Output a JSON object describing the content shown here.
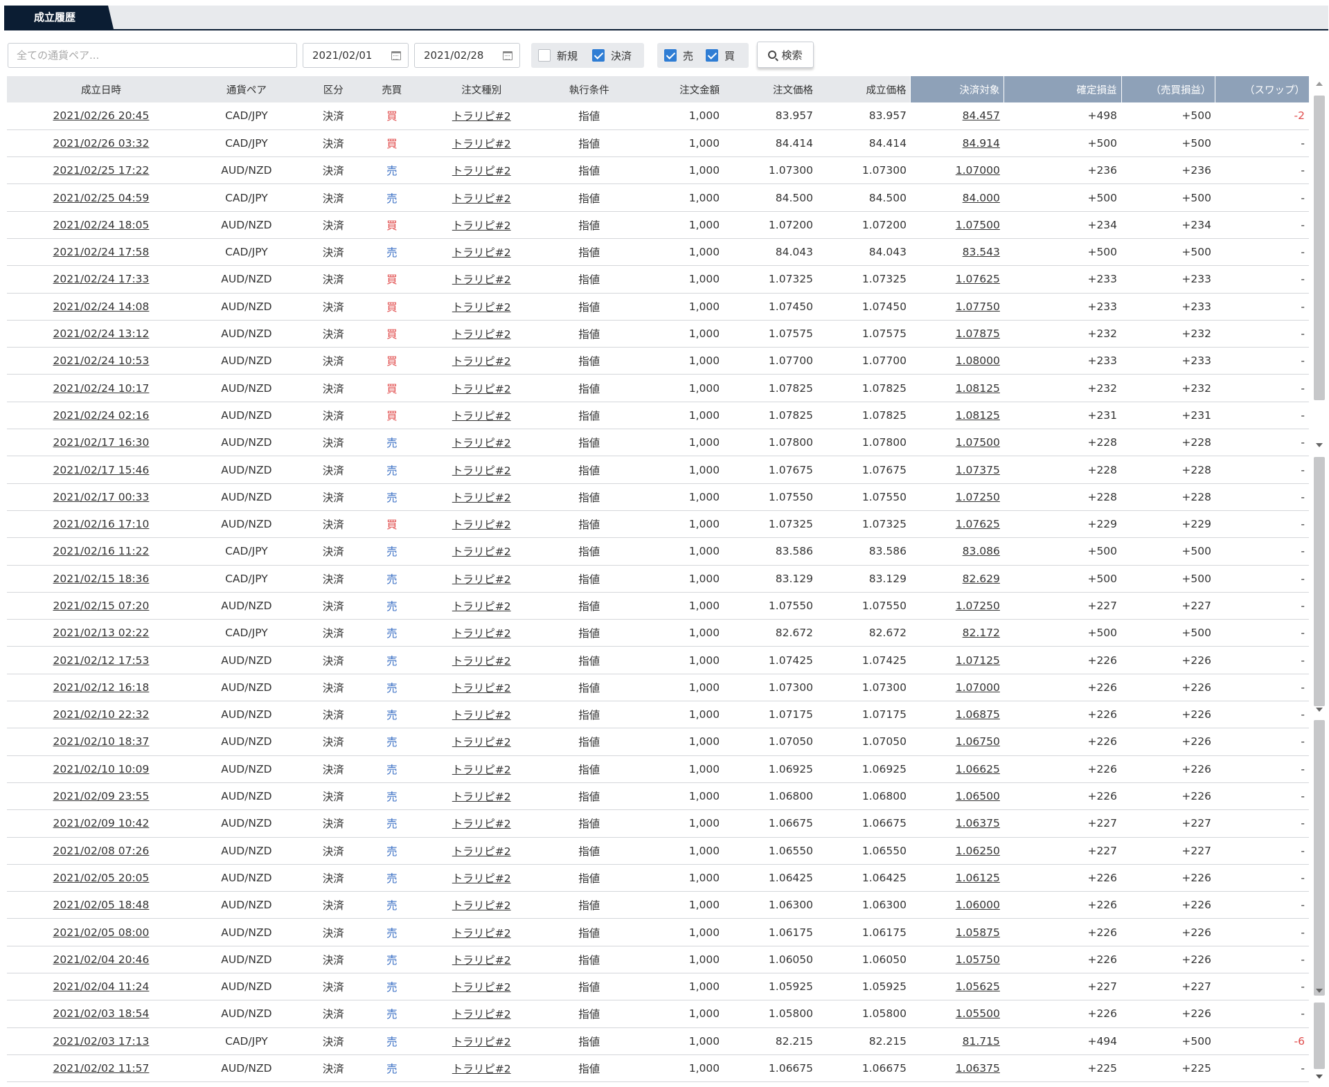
{
  "tabs": [
    {
      "label": "成立履歴"
    }
  ],
  "filters": {
    "pair_placeholder": "全ての通貨ペア...",
    "date_from": "2021/02/01",
    "date_to": "2021/02/28",
    "type_group": [
      {
        "label": "新規",
        "checked": false
      },
      {
        "label": "決済",
        "checked": true
      }
    ],
    "side_group": [
      {
        "label": "売",
        "checked": true
      },
      {
        "label": "買",
        "checked": true
      }
    ],
    "search_label": "検索"
  },
  "table": {
    "headers": [
      "成立日時",
      "通貨ペア",
      "区分",
      "売買",
      "注文種別",
      "執行条件",
      "注文金額",
      "注文価格",
      "成立価格",
      "決済対象",
      "確定損益",
      "（売買損益）",
      "（スワップ）"
    ],
    "colors": {
      "buy": "#e04a4a",
      "sell": "#3a6fc4",
      "highlight_header": "#8ea1b8",
      "negative": "#e04a4a"
    },
    "rows": [
      [
        "2021/02/26 20:45",
        "CAD/JPY",
        "決済",
        "買",
        "トラリピ#2",
        "指値",
        "1,000",
        "83.957",
        "83.957",
        "84.457",
        "+498",
        "+500",
        "-2"
      ],
      [
        "2021/02/26 03:32",
        "CAD/JPY",
        "決済",
        "買",
        "トラリピ#2",
        "指値",
        "1,000",
        "84.414",
        "84.414",
        "84.914",
        "+500",
        "+500",
        "-"
      ],
      [
        "2021/02/25 17:22",
        "AUD/NZD",
        "決済",
        "売",
        "トラリピ#2",
        "指値",
        "1,000",
        "1.07300",
        "1.07300",
        "1.07000",
        "+236",
        "+236",
        "-"
      ],
      [
        "2021/02/25 04:59",
        "CAD/JPY",
        "決済",
        "売",
        "トラリピ#2",
        "指値",
        "1,000",
        "84.500",
        "84.500",
        "84.000",
        "+500",
        "+500",
        "-"
      ],
      [
        "2021/02/24 18:05",
        "AUD/NZD",
        "決済",
        "買",
        "トラリピ#2",
        "指値",
        "1,000",
        "1.07200",
        "1.07200",
        "1.07500",
        "+234",
        "+234",
        "-"
      ],
      [
        "2021/02/24 17:58",
        "CAD/JPY",
        "決済",
        "売",
        "トラリピ#2",
        "指値",
        "1,000",
        "84.043",
        "84.043",
        "83.543",
        "+500",
        "+500",
        "-"
      ],
      [
        "2021/02/24 17:33",
        "AUD/NZD",
        "決済",
        "買",
        "トラリピ#2",
        "指値",
        "1,000",
        "1.07325",
        "1.07325",
        "1.07625",
        "+233",
        "+233",
        "-"
      ],
      [
        "2021/02/24 14:08",
        "AUD/NZD",
        "決済",
        "買",
        "トラリピ#2",
        "指値",
        "1,000",
        "1.07450",
        "1.07450",
        "1.07750",
        "+233",
        "+233",
        "-"
      ],
      [
        "2021/02/24 13:12",
        "AUD/NZD",
        "決済",
        "買",
        "トラリピ#2",
        "指値",
        "1,000",
        "1.07575",
        "1.07575",
        "1.07875",
        "+232",
        "+232",
        "-"
      ],
      [
        "2021/02/24 10:53",
        "AUD/NZD",
        "決済",
        "買",
        "トラリピ#2",
        "指値",
        "1,000",
        "1.07700",
        "1.07700",
        "1.08000",
        "+233",
        "+233",
        "-"
      ],
      [
        "2021/02/24 10:17",
        "AUD/NZD",
        "決済",
        "買",
        "トラリピ#2",
        "指値",
        "1,000",
        "1.07825",
        "1.07825",
        "1.08125",
        "+232",
        "+232",
        "-"
      ],
      [
        "2021/02/24 02:16",
        "AUD/NZD",
        "決済",
        "買",
        "トラリピ#2",
        "指値",
        "1,000",
        "1.07825",
        "1.07825",
        "1.08125",
        "+231",
        "+231",
        "-"
      ],
      [
        "2021/02/17 16:30",
        "AUD/NZD",
        "決済",
        "売",
        "トラリピ#2",
        "指値",
        "1,000",
        "1.07800",
        "1.07800",
        "1.07500",
        "+228",
        "+228",
        "-"
      ],
      [
        "2021/02/17 15:46",
        "AUD/NZD",
        "決済",
        "売",
        "トラリピ#2",
        "指値",
        "1,000",
        "1.07675",
        "1.07675",
        "1.07375",
        "+228",
        "+228",
        "-"
      ],
      [
        "2021/02/17 00:33",
        "AUD/NZD",
        "決済",
        "売",
        "トラリピ#2",
        "指値",
        "1,000",
        "1.07550",
        "1.07550",
        "1.07250",
        "+228",
        "+228",
        "-"
      ],
      [
        "2021/02/16 17:10",
        "AUD/NZD",
        "決済",
        "買",
        "トラリピ#2",
        "指値",
        "1,000",
        "1.07325",
        "1.07325",
        "1.07625",
        "+229",
        "+229",
        "-"
      ],
      [
        "2021/02/16 11:22",
        "CAD/JPY",
        "決済",
        "売",
        "トラリピ#2",
        "指値",
        "1,000",
        "83.586",
        "83.586",
        "83.086",
        "+500",
        "+500",
        "-"
      ],
      [
        "2021/02/15 18:36",
        "CAD/JPY",
        "決済",
        "売",
        "トラリピ#2",
        "指値",
        "1,000",
        "83.129",
        "83.129",
        "82.629",
        "+500",
        "+500",
        "-"
      ],
      [
        "2021/02/15 07:20",
        "AUD/NZD",
        "決済",
        "売",
        "トラリピ#2",
        "指値",
        "1,000",
        "1.07550",
        "1.07550",
        "1.07250",
        "+227",
        "+227",
        "-"
      ],
      [
        "2021/02/13 02:22",
        "CAD/JPY",
        "決済",
        "売",
        "トラリピ#2",
        "指値",
        "1,000",
        "82.672",
        "82.672",
        "82.172",
        "+500",
        "+500",
        "-"
      ],
      [
        "2021/02/12 17:53",
        "AUD/NZD",
        "決済",
        "売",
        "トラリピ#2",
        "指値",
        "1,000",
        "1.07425",
        "1.07425",
        "1.07125",
        "+226",
        "+226",
        "-"
      ],
      [
        "2021/02/12 16:18",
        "AUD/NZD",
        "決済",
        "売",
        "トラリピ#2",
        "指値",
        "1,000",
        "1.07300",
        "1.07300",
        "1.07000",
        "+226",
        "+226",
        "-"
      ],
      [
        "2021/02/10 22:32",
        "AUD/NZD",
        "決済",
        "売",
        "トラリピ#2",
        "指値",
        "1,000",
        "1.07175",
        "1.07175",
        "1.06875",
        "+226",
        "+226",
        "-"
      ],
      [
        "2021/02/10 18:37",
        "AUD/NZD",
        "決済",
        "売",
        "トラリピ#2",
        "指値",
        "1,000",
        "1.07050",
        "1.07050",
        "1.06750",
        "+226",
        "+226",
        "-"
      ],
      [
        "2021/02/10 10:09",
        "AUD/NZD",
        "決済",
        "売",
        "トラリピ#2",
        "指値",
        "1,000",
        "1.06925",
        "1.06925",
        "1.06625",
        "+226",
        "+226",
        "-"
      ],
      [
        "2021/02/09 23:55",
        "AUD/NZD",
        "決済",
        "売",
        "トラリピ#2",
        "指値",
        "1,000",
        "1.06800",
        "1.06800",
        "1.06500",
        "+226",
        "+226",
        "-"
      ],
      [
        "2021/02/09 10:42",
        "AUD/NZD",
        "決済",
        "売",
        "トラリピ#2",
        "指値",
        "1,000",
        "1.06675",
        "1.06675",
        "1.06375",
        "+227",
        "+227",
        "-"
      ],
      [
        "2021/02/08 07:26",
        "AUD/NZD",
        "決済",
        "売",
        "トラリピ#2",
        "指値",
        "1,000",
        "1.06550",
        "1.06550",
        "1.06250",
        "+227",
        "+227",
        "-"
      ],
      [
        "2021/02/05 20:05",
        "AUD/NZD",
        "決済",
        "売",
        "トラリピ#2",
        "指値",
        "1,000",
        "1.06425",
        "1.06425",
        "1.06125",
        "+226",
        "+226",
        "-"
      ],
      [
        "2021/02/05 18:48",
        "AUD/NZD",
        "決済",
        "売",
        "トラリピ#2",
        "指値",
        "1,000",
        "1.06300",
        "1.06300",
        "1.06000",
        "+226",
        "+226",
        "-"
      ],
      [
        "2021/02/05 08:00",
        "AUD/NZD",
        "決済",
        "売",
        "トラリピ#2",
        "指値",
        "1,000",
        "1.06175",
        "1.06175",
        "1.05875",
        "+226",
        "+226",
        "-"
      ],
      [
        "2021/02/04 20:46",
        "AUD/NZD",
        "決済",
        "売",
        "トラリピ#2",
        "指値",
        "1,000",
        "1.06050",
        "1.06050",
        "1.05750",
        "+226",
        "+226",
        "-"
      ],
      [
        "2021/02/04 11:24",
        "AUD/NZD",
        "決済",
        "売",
        "トラリピ#2",
        "指値",
        "1,000",
        "1.05925",
        "1.05925",
        "1.05625",
        "+227",
        "+227",
        "-"
      ],
      [
        "2021/02/03 18:54",
        "AUD/NZD",
        "決済",
        "売",
        "トラリピ#2",
        "指値",
        "1,000",
        "1.05800",
        "1.05800",
        "1.05500",
        "+226",
        "+226",
        "-"
      ],
      [
        "2021/02/03 17:13",
        "CAD/JPY",
        "決済",
        "売",
        "トラリピ#2",
        "指値",
        "1,000",
        "82.215",
        "82.215",
        "81.715",
        "+494",
        "+500",
        "-6"
      ],
      [
        "2021/02/02 11:57",
        "AUD/NZD",
        "決済",
        "売",
        "トラリピ#2",
        "指値",
        "1,000",
        "1.06675",
        "1.06675",
        "1.06375",
        "+225",
        "+225",
        "-"
      ]
    ]
  }
}
